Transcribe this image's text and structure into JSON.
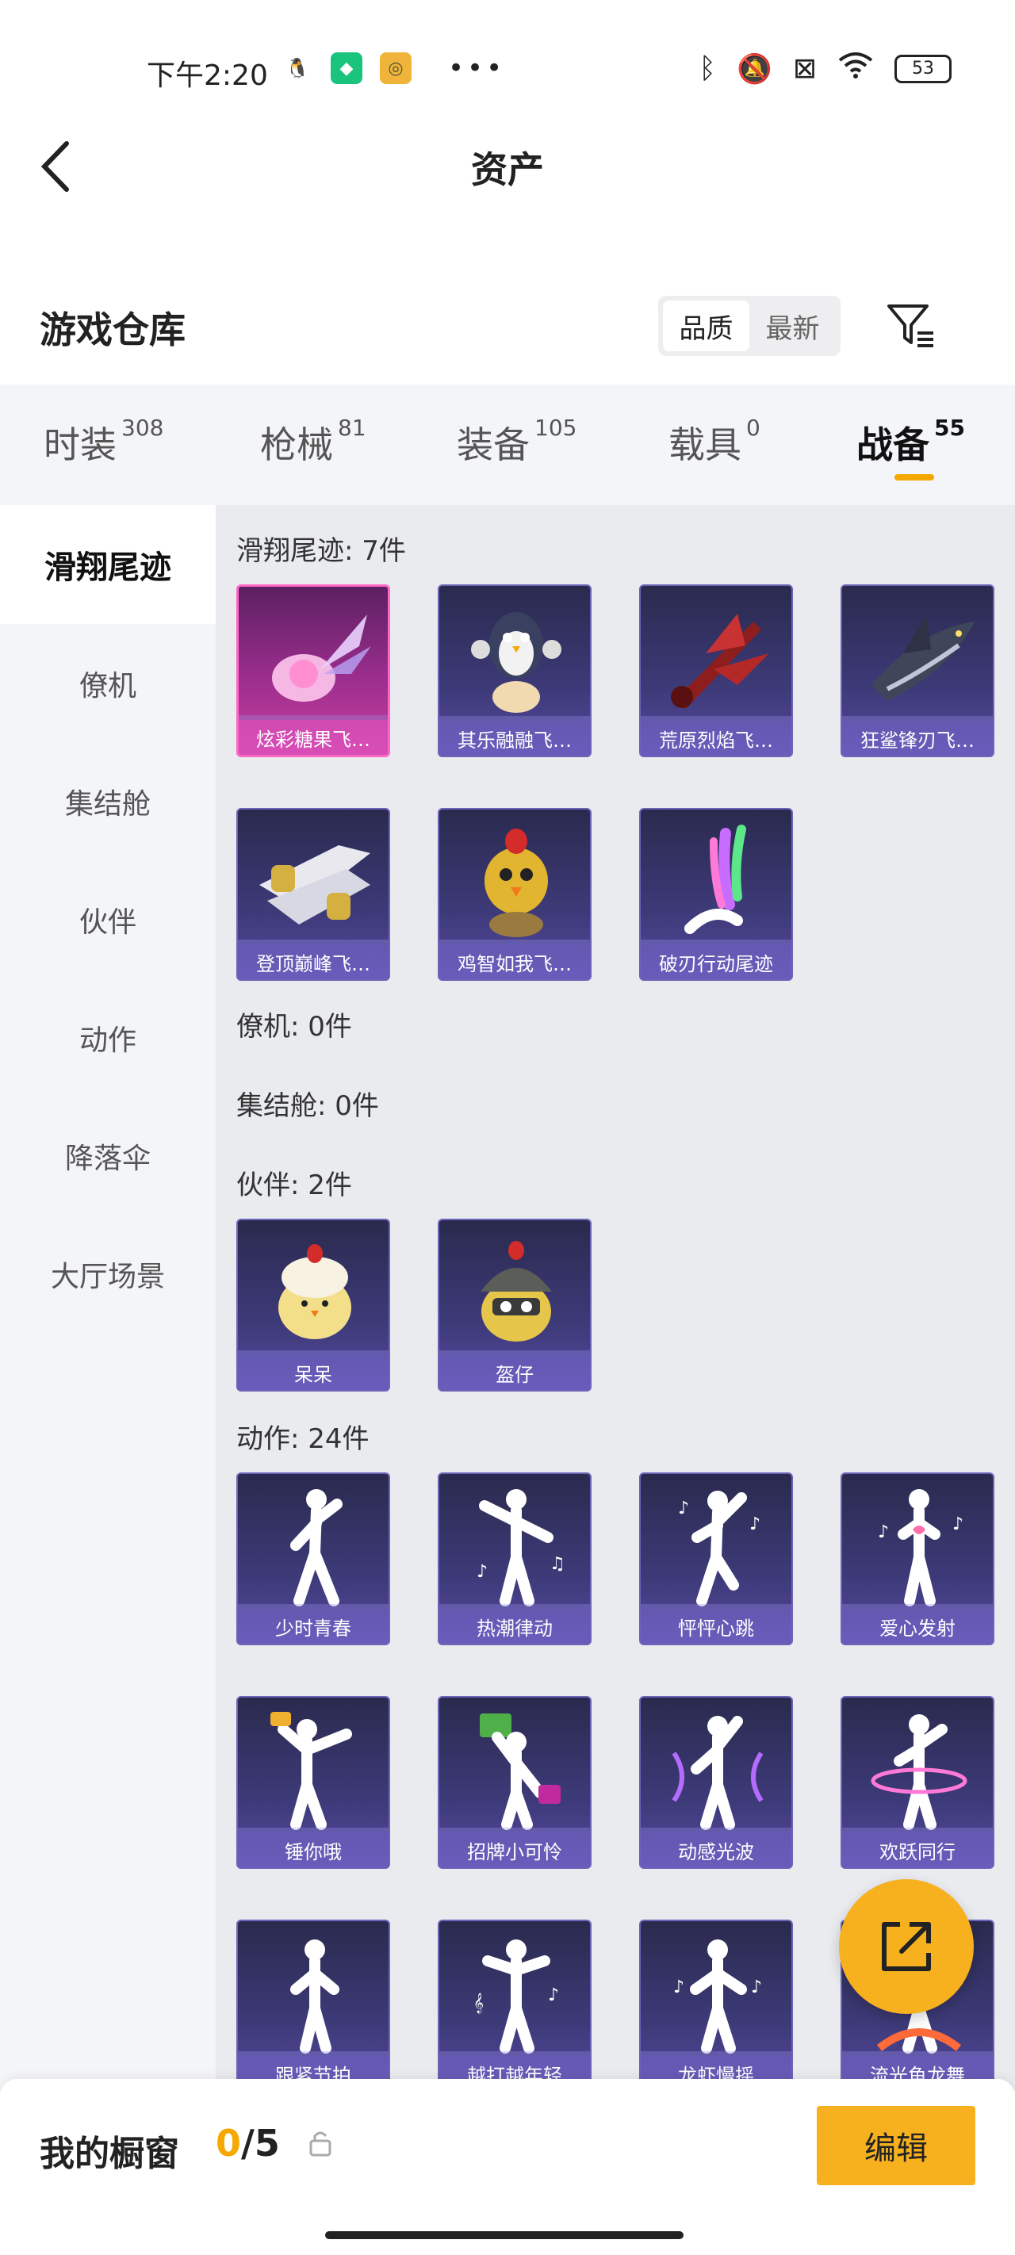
{
  "status_bar": {
    "time": "下午2:20",
    "battery": "53",
    "left_icons": [
      "qq-icon",
      "shield-app-icon",
      "camera-app-icon"
    ],
    "right_icons": [
      "bluetooth-icon",
      "mute-icon",
      "sim-icon",
      "wifi-icon"
    ]
  },
  "header": {
    "title": "资产"
  },
  "section": {
    "title": "游戏仓库",
    "sort_options": [
      "品质",
      "最新"
    ]
  },
  "tabs": [
    {
      "label": "时装",
      "count": "308"
    },
    {
      "label": "枪械",
      "count": "81"
    },
    {
      "label": "装备",
      "count": "105"
    },
    {
      "label": "载具",
      "count": "0"
    },
    {
      "label": "战备",
      "count": "55"
    }
  ],
  "sidebar": [
    "滑翔尾迹",
    "僚机",
    "集结舱",
    "伙伴",
    "动作",
    "降落伞",
    "大厅场景"
  ],
  "groups": {
    "glide": {
      "heading": "滑翔尾迹: 7件",
      "items": [
        "炫彩糖果飞…",
        "其乐融融飞…",
        "荒原烈焰飞…",
        "狂鲨锋刃飞…",
        "登顶巅峰飞…",
        "鸡智如我飞…",
        "破刃行动尾迹"
      ]
    },
    "wingman": {
      "heading": "僚机: 0件"
    },
    "pod": {
      "heading": "集结舱: 0件"
    },
    "partner": {
      "heading": "伙伴: 2件",
      "items": [
        "呆呆",
        "盔仔"
      ]
    },
    "emote": {
      "heading": "动作: 24件",
      "items": [
        "少时青春",
        "热潮律动",
        "怦怦心跳",
        "爱心发射",
        "锤你哦",
        "招牌小可怜",
        "动感光波",
        "欢跃同行",
        "跟紧节拍",
        "越打越年轻",
        "龙虾慢摇",
        "流光鱼龙舞"
      ]
    }
  },
  "bottom": {
    "showcase_label": "我的橱窗",
    "current": "0",
    "total": "/5",
    "edit_label": "编辑"
  },
  "colors": {
    "accent": "#f7b11f",
    "card_bg": "#3d3a78",
    "selected_card": "#c8409e"
  }
}
